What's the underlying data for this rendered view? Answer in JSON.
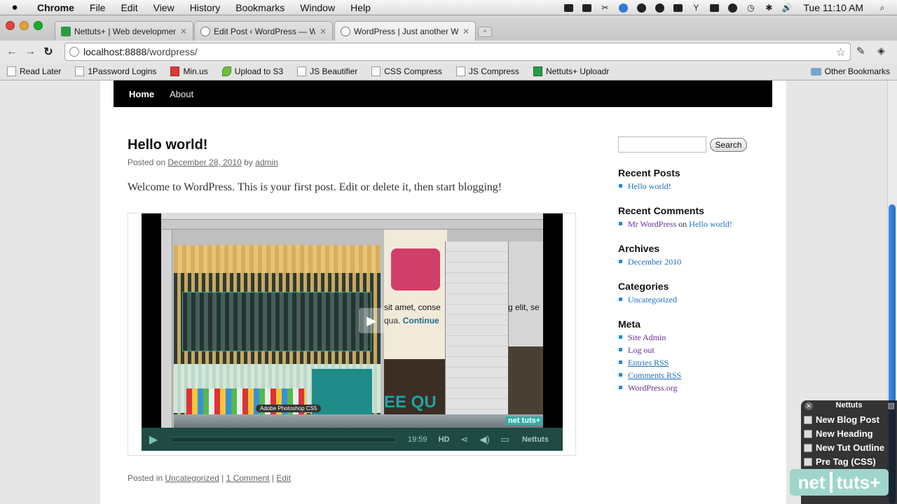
{
  "menubar": {
    "apple": "",
    "app": "Chrome",
    "items": [
      "File",
      "Edit",
      "View",
      "History",
      "Bookmarks",
      "Window",
      "Help"
    ],
    "clock": "Tue 11:10 AM"
  },
  "tabs": [
    {
      "title": "Nettuts+ | Web development",
      "favicon": "nettuts-favicon"
    },
    {
      "title": "Edit Post ‹ WordPress — Wor",
      "favicon": "wordpress-favicon"
    },
    {
      "title": "WordPress | Just another Wo",
      "favicon": "wordpress-favicon"
    }
  ],
  "toolbar": {
    "back": "←",
    "forward": "→",
    "reload": "↻",
    "url_host": "localhost:8888",
    "url_path": "/wordpress/",
    "star": "☆",
    "wrench": "🔧"
  },
  "bookmarks": {
    "items": [
      "Read Later",
      "1Password Logins",
      "Min.us",
      "Upload to S3",
      "JS Beautifier",
      "CSS Compress",
      "JS Compress",
      "Nettuts+ Uploadr"
    ],
    "other": "Other Bookmarks"
  },
  "site_nav": {
    "home": "Home",
    "about": "About"
  },
  "post": {
    "title": "Hello world!",
    "meta_prefix": "Posted on",
    "date": "December 28, 2010",
    "meta_by": "by",
    "author": "admin",
    "content": "Welcome to WordPress. This is your first post. Edit or delete it, then start blogging!",
    "util_prefix": "Posted in",
    "category": "Uncategorized",
    "comments": "1 Comment",
    "edit": "Edit"
  },
  "video": {
    "text_line1": "sit amet, conse",
    "text_line2_plain": "qua.",
    "text_line2_link": "Continue",
    "quote": "EE QU",
    "right_text": "g elit, se",
    "dock_tooltip": "Adobe Photoshop CS5",
    "watermark": "net tuts+",
    "time": "19:59",
    "hd": "HD",
    "brand": "Nettuts"
  },
  "sidebar": {
    "search_button": "Search",
    "recent_posts": {
      "title": "Recent Posts",
      "items": [
        "Hello world!"
      ]
    },
    "recent_comments": {
      "title": "Recent Comments",
      "author": "Mr WordPress",
      "on": "on",
      "post": "Hello world!"
    },
    "archives": {
      "title": "Archives",
      "items": [
        "December 2010"
      ]
    },
    "categories": {
      "title": "Categories",
      "items": [
        "Uncategorized"
      ]
    },
    "meta": {
      "title": "Meta",
      "items": [
        "Site Admin",
        "Log out",
        "Entries RSS",
        "Comments RSS",
        "WordPress.org"
      ]
    }
  },
  "nettuts_panel": {
    "title": "Nettuts",
    "items": [
      "New Blog Post",
      "New Heading",
      "New Tut Outline",
      "Pre Tag (CSS)"
    ],
    "logo_left": "net",
    "logo_right": "tuts+"
  },
  "colors": {
    "link": "#1b6fc2",
    "visited": "#6a2c95",
    "accent_blue": "#1b8be0"
  }
}
